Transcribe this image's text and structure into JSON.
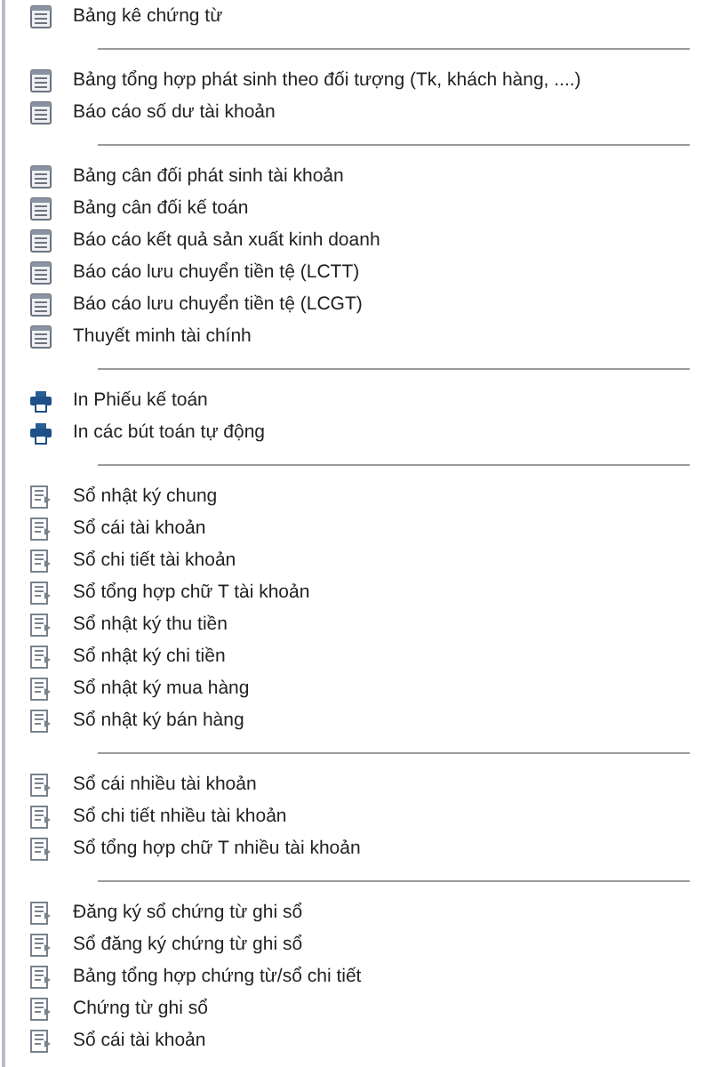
{
  "menu_groups": [
    {
      "items": [
        {
          "kind": "report",
          "label": "Bảng kê chứng từ"
        }
      ]
    },
    {
      "items": [
        {
          "kind": "report",
          "label": "Bảng tổng hợp phát sinh theo đối tượng (Tk, khách hàng, ....)"
        },
        {
          "kind": "report",
          "label": "Báo cáo số dư tài khoản"
        }
      ]
    },
    {
      "items": [
        {
          "kind": "report",
          "label": "Bảng cân đối phát sinh tài khoản"
        },
        {
          "kind": "report",
          "label": "Bảng cân đối kế toán"
        },
        {
          "kind": "report",
          "label": "Báo cáo kết quả sản xuất kinh doanh"
        },
        {
          "kind": "report",
          "label": "Báo cáo lưu chuyển tiền tệ (LCTT)"
        },
        {
          "kind": "report",
          "label": "Báo cáo lưu chuyển tiền tệ (LCGT)"
        },
        {
          "kind": "report",
          "label": "Thuyết minh tài chính"
        }
      ]
    },
    {
      "items": [
        {
          "kind": "print",
          "label": "In Phiếu kế toán"
        },
        {
          "kind": "print",
          "label": "In các bút toán tự động"
        }
      ]
    },
    {
      "items": [
        {
          "kind": "ledger",
          "label": "Sổ nhật ký chung"
        },
        {
          "kind": "ledger",
          "label": "Sổ cái tài khoản"
        },
        {
          "kind": "ledger",
          "label": "Sổ chi tiết tài khoản"
        },
        {
          "kind": "ledger",
          "label": "Sổ tổng hợp chữ T tài khoản"
        },
        {
          "kind": "ledger",
          "label": "Sổ nhật ký thu tiền"
        },
        {
          "kind": "ledger",
          "label": "Sổ nhật ký chi tiền"
        },
        {
          "kind": "ledger",
          "label": "Sổ nhật ký mua hàng"
        },
        {
          "kind": "ledger",
          "label": "Sổ nhật ký bán hàng"
        }
      ]
    },
    {
      "items": [
        {
          "kind": "ledger",
          "label": "Sổ cái nhiều tài khoản"
        },
        {
          "kind": "ledger",
          "label": "Sổ chi tiết nhiều tài khoản"
        },
        {
          "kind": "ledger",
          "label": "Sổ tổng hợp chữ T nhiều tài khoản"
        }
      ]
    },
    {
      "items": [
        {
          "kind": "ledger",
          "label": "Đăng ký sổ chứng từ ghi sổ"
        },
        {
          "kind": "ledger",
          "label": "Sổ đăng ký chứng từ ghi sổ"
        },
        {
          "kind": "ledger",
          "label": "Bảng tổng hợp chứng từ/sổ chi tiết"
        },
        {
          "kind": "ledger",
          "label": "Chứng từ ghi sổ"
        },
        {
          "kind": "ledger",
          "label": "Sổ cái tài khoản"
        }
      ]
    }
  ]
}
